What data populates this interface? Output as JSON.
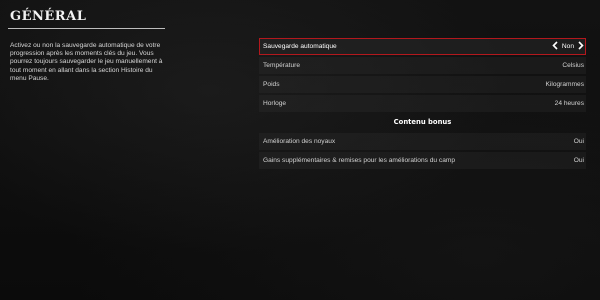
{
  "page": {
    "title": "GÉNÉRAL",
    "description": "Activez ou non la sauvegarde automatique de votre progression après les moments clés du jeu. Vous pourrez toujours sauvegarder le jeu manuellement à tout moment en allant dans la section Histoire du menu Pause."
  },
  "settings": {
    "items": [
      {
        "label": "Sauvegarde automatique",
        "value": "Non"
      },
      {
        "label": "Température",
        "value": "Celsius"
      },
      {
        "label": "Poids",
        "value": "Kilogrammes"
      },
      {
        "label": "Horloge",
        "value": "24 heures"
      }
    ],
    "bonus_header": "Contenu bonus",
    "bonus_items": [
      {
        "label": "Amélioration des noyaux",
        "value": "Oui"
      },
      {
        "label": "Gains supplémentaires & remises pour les améliorations du camp",
        "value": "Oui"
      }
    ]
  },
  "colors": {
    "background": "#0e0e0e",
    "selection_border": "#b3181d",
    "text": "#d9d9d9"
  },
  "icons": {
    "prev": "chevron-left-icon",
    "next": "chevron-right-icon"
  }
}
